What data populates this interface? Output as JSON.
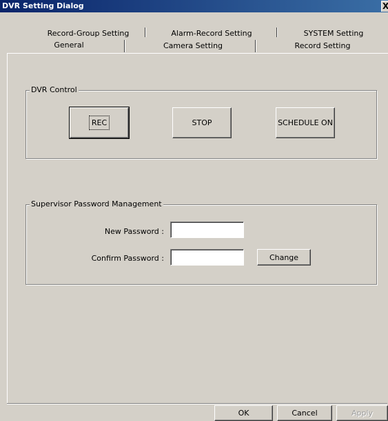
{
  "window": {
    "title": "DVR Setting Dialog",
    "close_glyph": "X"
  },
  "tabs": {
    "row1": [
      {
        "label": "Record-Group Setting"
      },
      {
        "label": "Alarm-Record Setting"
      },
      {
        "label": "SYSTEM Setting"
      }
    ],
    "row2": [
      {
        "label": "General",
        "active": true
      },
      {
        "label": "Camera Setting"
      },
      {
        "label": "Record Setting"
      }
    ]
  },
  "dvr_control": {
    "legend": "DVR Control",
    "rec_label": "REC",
    "stop_label": "STOP",
    "schedule_label": "SCHEDULE ON"
  },
  "password": {
    "legend": "Supervisor Password Management",
    "new_label": "New Password :",
    "new_value": "",
    "confirm_label": "Confirm Password :",
    "confirm_value": "",
    "change_label": "Change"
  },
  "footer": {
    "ok_label": "OK",
    "cancel_label": "Cancel",
    "apply_label": "Apply"
  },
  "colors": {
    "face": "#d4d0c8",
    "titlebar_start": "#0a246a",
    "titlebar_end": "#3a6ea5"
  }
}
